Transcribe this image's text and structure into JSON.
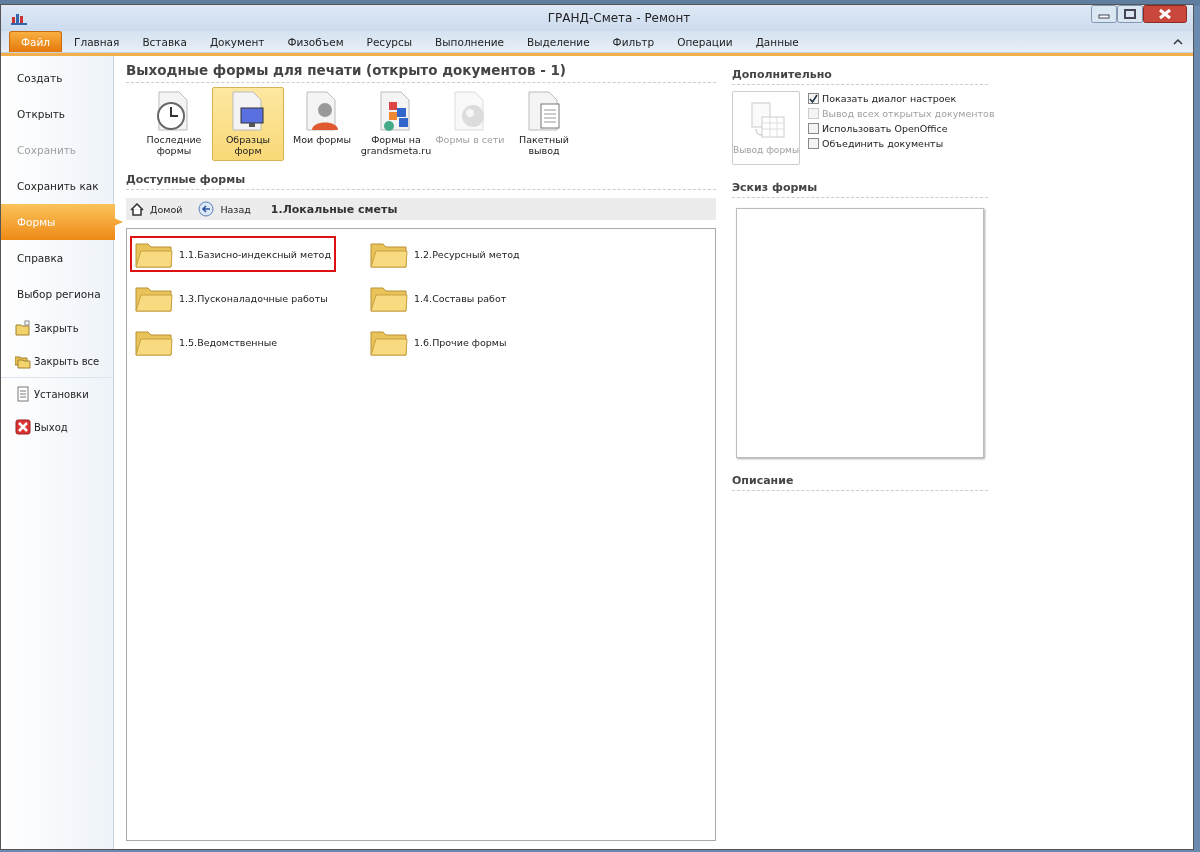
{
  "window": {
    "title": "ГРАНД-Смета - Ремонт"
  },
  "ribbon_tabs": [
    {
      "label": "Файл",
      "selected": true
    },
    {
      "label": "Главная",
      "selected": false
    },
    {
      "label": "Вставка",
      "selected": false
    },
    {
      "label": "Документ",
      "selected": false
    },
    {
      "label": "Физобъем",
      "selected": false
    },
    {
      "label": "Ресурсы",
      "selected": false
    },
    {
      "label": "Выполнение",
      "selected": false
    },
    {
      "label": "Выделение",
      "selected": false
    },
    {
      "label": "Фильтр",
      "selected": false
    },
    {
      "label": "Операции",
      "selected": false
    },
    {
      "label": "Данные",
      "selected": false
    }
  ],
  "sidebar": {
    "items": [
      {
        "kind": "big",
        "label": "Создать",
        "selected": false,
        "disabled": false
      },
      {
        "kind": "big",
        "label": "Открыть",
        "selected": false,
        "disabled": false
      },
      {
        "kind": "big",
        "label": "Сохранить",
        "selected": false,
        "disabled": true
      },
      {
        "kind": "big",
        "label": "Сохранить как",
        "selected": false,
        "disabled": false
      },
      {
        "kind": "big",
        "label": "Формы",
        "selected": true,
        "disabled": false
      },
      {
        "kind": "big",
        "label": "Справка",
        "selected": false,
        "disabled": false
      },
      {
        "kind": "big",
        "label": "Выбор региона",
        "selected": false,
        "disabled": false
      },
      {
        "kind": "small",
        "label": "Закрыть",
        "selected": false,
        "disabled": false
      },
      {
        "kind": "small",
        "label": "Закрыть все",
        "selected": false,
        "disabled": false
      },
      {
        "kind": "small",
        "label": "Установки",
        "selected": false,
        "disabled": false
      },
      {
        "kind": "small",
        "label": "Выход",
        "selected": false,
        "disabled": false
      }
    ]
  },
  "main": {
    "title": "Выходные формы для печати (открыто документов - 1)",
    "sources": [
      {
        "label": "Последние формы",
        "selected": false,
        "disabled": false
      },
      {
        "label": "Образцы форм",
        "selected": true,
        "disabled": false
      },
      {
        "label": "Мои формы",
        "selected": false,
        "disabled": false
      },
      {
        "label": "Формы на grandsmeta.ru",
        "selected": false,
        "disabled": false
      },
      {
        "label": "Формы в сети",
        "selected": false,
        "disabled": true
      },
      {
        "label": "Пакетный вывод",
        "selected": false,
        "disabled": false
      }
    ],
    "section_title": "Доступные формы",
    "breadcrumb": {
      "home": "Домой",
      "back": "Назад",
      "path": "1.Локальные сметы"
    },
    "folders": [
      {
        "label": "1.1.Базисно-индексный метод",
        "selected": true
      },
      {
        "label": "1.2.Ресурсный метод",
        "selected": false
      },
      {
        "label": "1.3.Пусконаладочные работы",
        "selected": false
      },
      {
        "label": "1.4.Составы работ",
        "selected": false
      },
      {
        "label": "1.5.Ведомственные",
        "selected": false
      },
      {
        "label": "1.6.Прочие формы",
        "selected": false
      }
    ]
  },
  "right": {
    "additional_title": "Дополнительно",
    "output_button": {
      "label": "Вывод формы",
      "disabled": true
    },
    "options": [
      {
        "label": "Показать диалог настроек",
        "checked": true,
        "disabled": false
      },
      {
        "label": "Вывод всех открытых документов",
        "checked": false,
        "disabled": true
      },
      {
        "label": "Использовать OpenOffice",
        "checked": false,
        "disabled": false
      },
      {
        "label": "Объединить документы",
        "checked": false,
        "disabled": false
      }
    ],
    "sketch_title": "Эскиз формы",
    "description_title": "Описание"
  }
}
